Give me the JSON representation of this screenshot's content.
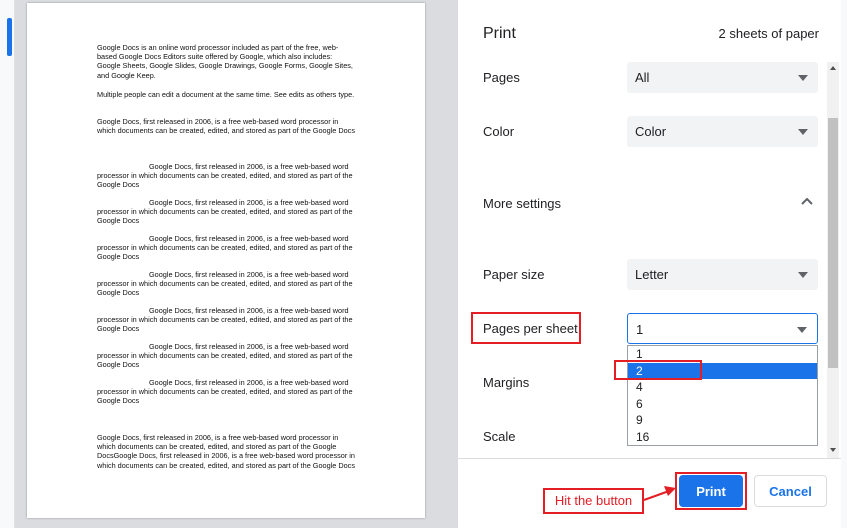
{
  "document": {
    "paragraphs": [
      "Google Docs is an online word processor included as part of the free, web-based Google Docs Editors suite offered by Google, which also includes: Google Sheets, Google Slides, Google Drawings, Google Forms, Google Sites, and Google Keep.",
      "Multiple people can edit a document at the same time. See edits as others type.",
      "Google Docs, first released in 2006, is a free web-based word processor in which documents can be created, edited, and stored as part of the Google Docs",
      "Google Docs, first released in 2006, is a free web-based word processor in which documents can be created, edited, and stored as part of the Google Docs",
      "Google Docs, first released in 2006, is a free web-based word processor in which documents can be created, edited, and stored as part of the Google Docs",
      "Google Docs, first released in 2006, is a free web-based word processor in which documents can be created, edited, and stored as part of the Google Docs",
      "Google Docs, first released in 2006, is a free web-based word processor in which documents can be created, edited, and stored as part of the Google Docs",
      "Google Docs, first released in 2006, is a free web-based word processor in which documents can be created, edited, and stored as part of the Google Docs",
      "Google Docs, first released in 2006, is a free web-based word processor in which documents can be created, edited, and stored as part of the Google Docs",
      "Google Docs, first released in 2006, is a free web-based word processor in which documents can be created, edited, and stored as part of the Google Docs",
      "Google Docs, first released in 2006, is a free web-based word processor in which documents can be created, edited, and stored as part of the Google DocsGoogle Docs, first released in 2006, is a free web-based word processor in which documents can be created, edited, and stored as part of the Google Docs"
    ]
  },
  "print": {
    "title": "Print",
    "sheets": "2 sheets of paper",
    "pages_label": "Pages",
    "pages_value": "All",
    "color_label": "Color",
    "color_value": "Color",
    "more_settings_label": "More settings",
    "paper_size_label": "Paper size",
    "paper_size_value": "Letter",
    "pages_per_sheet_label": "Pages per sheet",
    "pages_per_sheet_value": "1",
    "pages_per_sheet_options": [
      "1",
      "2",
      "4",
      "6",
      "9",
      "16"
    ],
    "margins_label": "Margins",
    "scale_label": "Scale",
    "print_button": "Print",
    "cancel_button": "Cancel"
  },
  "annotation": {
    "hit_label": "Hit the button",
    "color": "#e31e24"
  },
  "icons": {
    "more_settings": "chevron-up-icon",
    "dropdown": "chevron-down-icon"
  },
  "colors": {
    "accent": "#1a73e8",
    "annotation": "#e31e24"
  }
}
